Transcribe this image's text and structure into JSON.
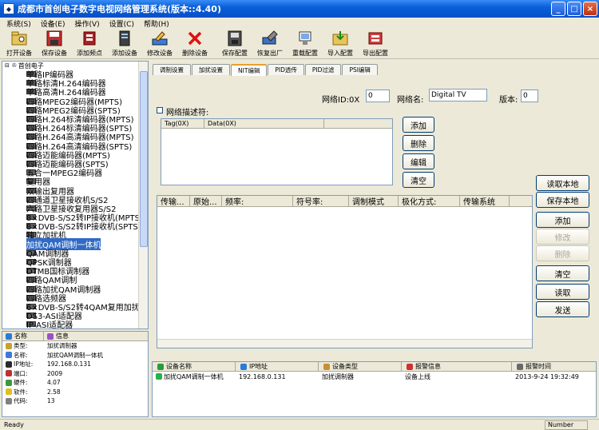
{
  "window": {
    "title": "成都市首创电子数字电视网络管理系统(版本::4.40)"
  },
  "menu": [
    "系统(S)",
    "设备(E)",
    "操作(V)",
    "设置(C)",
    "帮助(H)"
  ],
  "toolbar": [
    {
      "label": "打开设备",
      "icon": "open-device-icon"
    },
    {
      "label": "保存设备",
      "icon": "save-disk-icon"
    },
    {
      "label": "添加频点",
      "icon": "add-freq-icon"
    },
    {
      "label": "添加设备",
      "icon": "add-device-icon"
    },
    {
      "label": "修改设备",
      "icon": "edit-device-icon"
    },
    {
      "label": "删除设备",
      "icon": "delete-x-icon"
    },
    {
      "label": "保存配置",
      "icon": "save-config-icon"
    },
    {
      "label": "恢复出厂",
      "icon": "restore-factory-icon"
    },
    {
      "label": "重载配置",
      "icon": "reload-config-icon"
    },
    {
      "label": "导入配置",
      "icon": "import-config-icon"
    },
    {
      "label": "导出配置",
      "icon": "export-config-icon"
    }
  ],
  "tree": {
    "root": "首创电子",
    "items": [
      "单路IP编码器",
      "单路标清H.264编码器",
      "单路高清H.264编码器",
      "四路MPEG2编码器(MPTS)",
      "四路MPEG2编码器(SPTS)",
      "四路H.264标清编码器(MPTS)",
      "四路H.264标清编码器(SPTS)",
      "四路H.264高清编码器(MPTS)",
      "四路H.264高清编码器(SPTS)",
      "四路迈能编码器(MPTS)",
      "四路迈能编码器(SPTS)",
      "五合一MPEG2编码器",
      "复用器",
      "双输出复用器",
      "四通道卫星接收机S/S2",
      "六路卫星接收复用器S/S2",
      "8×DVB-S/S2转IP接收机(MPTS)",
      "8×DVB-S/S2转IP接收机(SPTS)",
      "独立加扰机",
      "加扰QAM调制一体机",
      "QAM调制器",
      "QPSK调制器",
      "DTMB国标调制器",
      "四路QAM调制",
      "四路加扰QAM调制器",
      "四路选频器",
      "6×DVB-S/S2转4QAM复用加扰调制器",
      "DS3-ASI适配器",
      "IP-ASI适配器"
    ],
    "selected_index": 19
  },
  "info": {
    "headers": [
      "名称",
      "信息"
    ],
    "rows": [
      {
        "key": "类型:",
        "value": "加扰调制器"
      },
      {
        "key": "名称:",
        "value": "加扰QAM调制一体机"
      },
      {
        "key": "IP地址:",
        "value": "192.168.0.131"
      },
      {
        "key": "端口:",
        "value": "2009"
      },
      {
        "key": "硬件:",
        "value": "4.07"
      },
      {
        "key": "软件:",
        "value": "2.58"
      },
      {
        "key": "代码:",
        "value": "13"
      }
    ]
  },
  "tabs": [
    "调制设置",
    "加扰设置",
    "NIT编辑",
    "PID透传",
    "PID过滤",
    "PSI编辑"
  ],
  "active_tab": 2,
  "network": {
    "id_label": "网络ID:0X",
    "id_value": "0",
    "name_label": "网络名:",
    "name_value": "Digital TV",
    "version_label": "版本:",
    "version_value": "0"
  },
  "descriptor": {
    "checkbox_label": "网络描述符:",
    "columns": [
      "Tag(0X)",
      "Data(0X)"
    ],
    "buttons": [
      "添加",
      "删除",
      "编辑",
      "清空"
    ]
  },
  "main_table": {
    "columns": [
      "传输...",
      "原始...",
      "频率:",
      "符号率:",
      "调制模式",
      "极化方式:",
      "传输系统",
      ""
    ]
  },
  "right_buttons": [
    {
      "label": "读取本地",
      "enabled": true
    },
    {
      "label": "保存本地",
      "enabled": true
    },
    {
      "label": "添加",
      "enabled": true
    },
    {
      "label": "修改",
      "enabled": false
    },
    {
      "label": "删除",
      "enabled": false
    },
    {
      "label": "清空",
      "enabled": true
    },
    {
      "label": "读取",
      "enabled": true
    },
    {
      "label": "发送",
      "enabled": true
    }
  ],
  "log": {
    "columns": [
      "设备名称",
      "IP地址",
      "设备类型",
      "报警信息",
      "报警时间"
    ],
    "rows": [
      {
        "name": "加扰QAM调制一体机",
        "ip": "192.168.0.131",
        "type": "加扰调制器",
        "alarm": "设备上线",
        "time": "2013-9-24 19:32:49"
      }
    ]
  },
  "status": {
    "left": "Ready",
    "right": "Number"
  }
}
